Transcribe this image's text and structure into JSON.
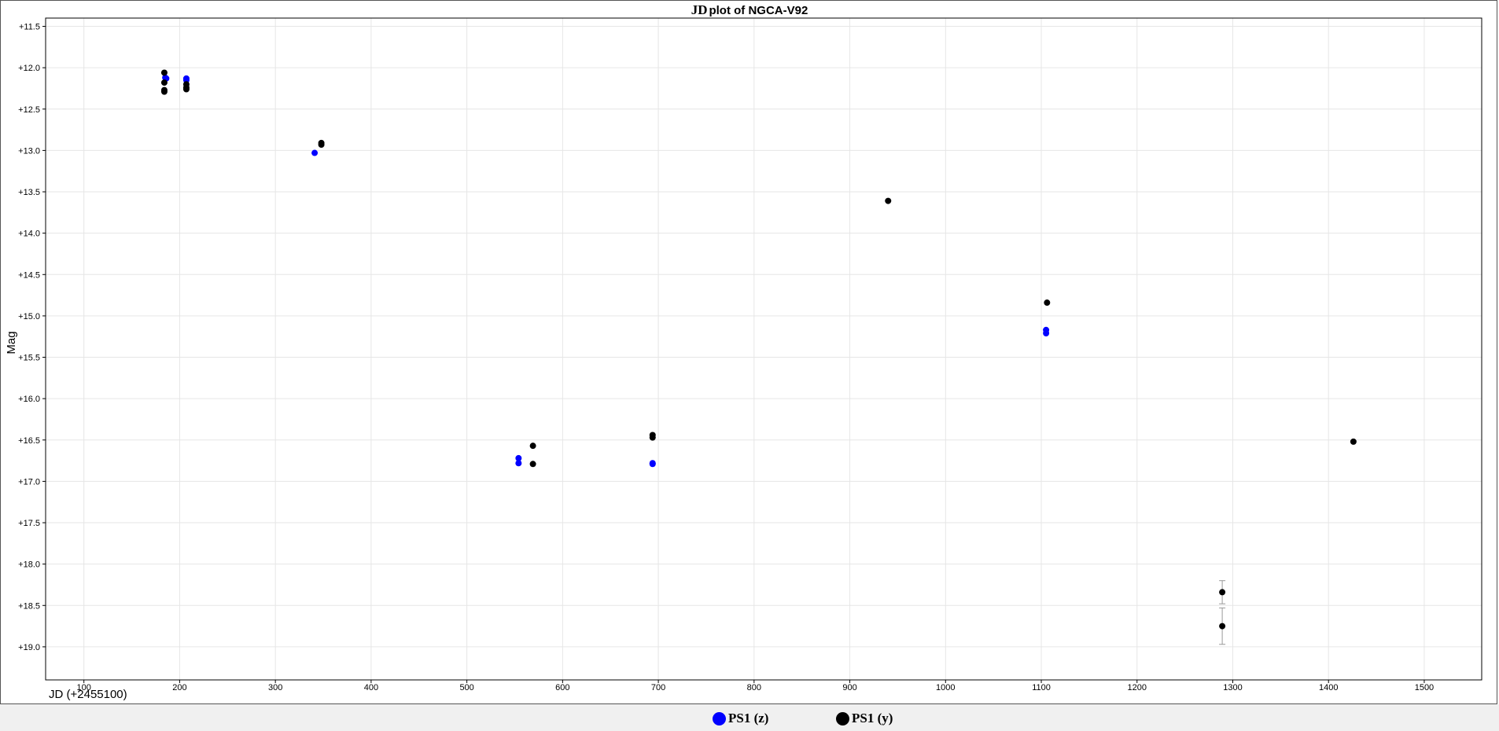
{
  "chart_data": {
    "type": "scatter",
    "title": "JD plot of NGCA-V92",
    "title_prefix": "JD",
    "title_rest": "plot of NGCA-V92",
    "xlabel": "JD (+2455100)",
    "ylabel": "Mag",
    "xlim": [
      60,
      1560
    ],
    "ylim": [
      19.4,
      11.4
    ],
    "y_inverted": true,
    "x_ticks": [
      100,
      200,
      300,
      400,
      500,
      600,
      700,
      800,
      900,
      1000,
      1100,
      1200,
      1300,
      1400,
      1500
    ],
    "x_tick_labels": [
      "100",
      "200",
      "300",
      "400",
      "500",
      "600",
      "700",
      "800",
      "900",
      "1000",
      "1100",
      "1200",
      "1300",
      "1400",
      "1500"
    ],
    "y_ticks": [
      11.5,
      12.0,
      12.5,
      13.0,
      13.5,
      14.0,
      14.5,
      15.0,
      15.5,
      16.0,
      16.5,
      17.0,
      17.5,
      18.0,
      18.5,
      19.0
    ],
    "y_tick_labels": [
      "+11.5",
      "+12.0",
      "+12.5",
      "+13.0",
      "+13.5",
      "+14.0",
      "+14.5",
      "+15.0",
      "+15.5",
      "+16.0",
      "+16.5",
      "+17.0",
      "+17.5",
      "+18.0",
      "+18.5",
      "+19.0"
    ],
    "grid": true,
    "legend_position": "bottom-center",
    "series": [
      {
        "name": "PS1 (z)",
        "color": "#0000ff",
        "points": [
          {
            "x": 185,
            "y": 12.12
          },
          {
            "x": 186,
            "y": 12.13
          },
          {
            "x": 207,
            "y": 12.13
          },
          {
            "x": 207,
            "y": 12.15
          },
          {
            "x": 341,
            "y": 13.03
          },
          {
            "x": 554,
            "y": 16.72
          },
          {
            "x": 554,
            "y": 16.78
          },
          {
            "x": 694,
            "y": 16.78
          },
          {
            "x": 694,
            "y": 16.79
          },
          {
            "x": 1105,
            "y": 15.17
          },
          {
            "x": 1105,
            "y": 15.21
          }
        ]
      },
      {
        "name": "PS1 (y)",
        "color": "#000000",
        "points": [
          {
            "x": 184,
            "y": 12.06
          },
          {
            "x": 184,
            "y": 12.18
          },
          {
            "x": 184,
            "y": 12.27
          },
          {
            "x": 184,
            "y": 12.29
          },
          {
            "x": 207,
            "y": 12.2
          },
          {
            "x": 207,
            "y": 12.24
          },
          {
            "x": 207,
            "y": 12.26
          },
          {
            "x": 348,
            "y": 12.91
          },
          {
            "x": 348,
            "y": 12.93
          },
          {
            "x": 569,
            "y": 16.57
          },
          {
            "x": 569,
            "y": 16.79
          },
          {
            "x": 694,
            "y": 16.44
          },
          {
            "x": 694,
            "y": 16.47
          },
          {
            "x": 940,
            "y": 13.61
          },
          {
            "x": 1106,
            "y": 14.84
          },
          {
            "x": 1289,
            "y": 18.34,
            "err": 0.14
          },
          {
            "x": 1289,
            "y": 18.75,
            "err": 0.22
          },
          {
            "x": 1426,
            "y": 16.52
          }
        ]
      }
    ]
  },
  "legend": {
    "items": [
      {
        "label": "PS1 (z)",
        "color": "#0000ff"
      },
      {
        "label": "PS1 (y)",
        "color": "#000000"
      }
    ]
  }
}
